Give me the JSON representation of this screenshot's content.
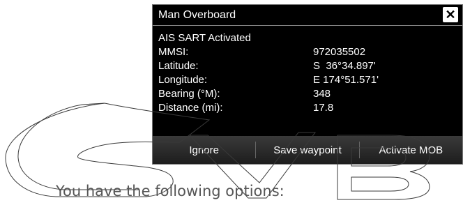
{
  "dialog": {
    "title": "Man Overboard",
    "close_icon": "close-icon",
    "heading": "AIS SART Activated",
    "rows": [
      {
        "label": "MMSI:",
        "value": "972035502"
      },
      {
        "label": "Latitude:",
        "value": "S  36°34.897'"
      },
      {
        "label": "Longitude:",
        "value": "E 174°51.571'"
      },
      {
        "label": "Bearing (°M):",
        "value": "348"
      },
      {
        "label": "Distance (mi):",
        "value": "17.8"
      }
    ],
    "buttons": {
      "ignore": "Ignore",
      "save_waypoint": "Save waypoint",
      "activate_mob": "Activate MOB"
    },
    "colors": {
      "background": "#000000",
      "text": "#ffffff",
      "button_bar": "#2a2a2a"
    }
  },
  "watermark_text": "SVB",
  "body_text": "You have the following options:"
}
